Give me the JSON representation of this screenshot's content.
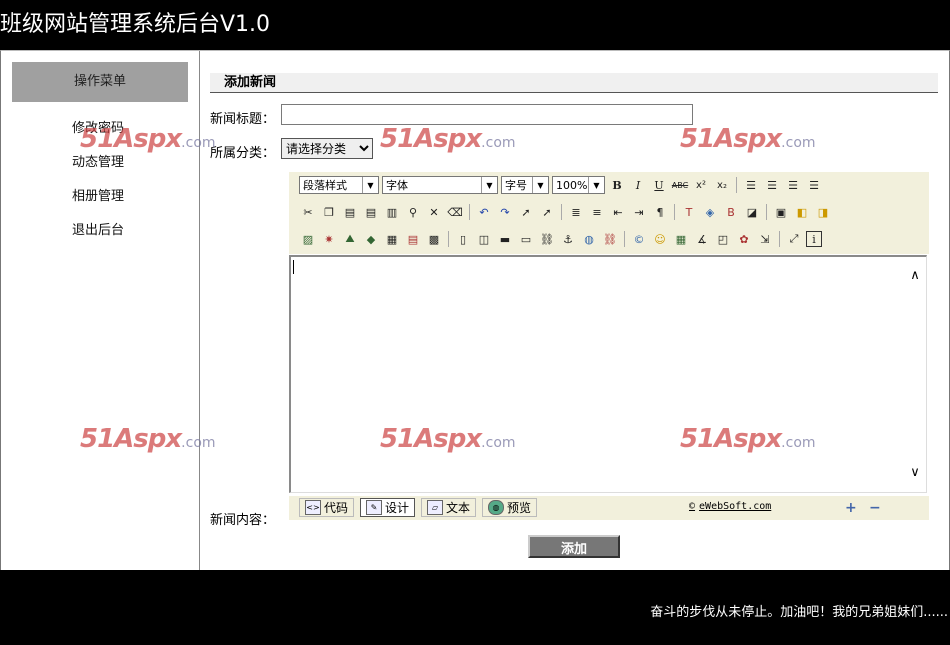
{
  "header": {
    "title": "班级网站管理系统后台V1.0"
  },
  "sidebar": {
    "menu_title": "操作菜单",
    "items": [
      {
        "label": "修改密码"
      },
      {
        "label": "动态管理"
      },
      {
        "label": "相册管理"
      },
      {
        "label": "退出后台"
      }
    ]
  },
  "main": {
    "section_title": "添加新闻",
    "news_title_label": "新闻标题：",
    "news_title_value": "",
    "category_label": "所属分类：",
    "category_selected": "请选择分类",
    "content_label": "新闻内容：",
    "submit_label": "添加"
  },
  "editor": {
    "dropdowns": {
      "paragraph_style": "段落样式",
      "font": "字体",
      "font_size": "字号",
      "zoom": "100%"
    },
    "format_buttons": {
      "bold": "B",
      "italic": "I",
      "underline": "U",
      "strike": "ABC",
      "superscript": "x²",
      "subscript": "x₂"
    },
    "modes": [
      {
        "label": "代码",
        "icon": "code-icon"
      },
      {
        "label": "设计",
        "icon": "design-icon",
        "active": true
      },
      {
        "label": "文本",
        "icon": "text-icon"
      },
      {
        "label": "预览",
        "icon": "preview-icon"
      }
    ],
    "brand": "eWebSoft.com",
    "copyright_symbol": "©",
    "zoom_in": "+",
    "zoom_out": "−"
  },
  "footer": {
    "message": "奋斗的步伐从未停止。加油吧！我的兄弟姐妹们......"
  },
  "watermark": {
    "text": "51Aspx",
    "suffix": ".com"
  }
}
